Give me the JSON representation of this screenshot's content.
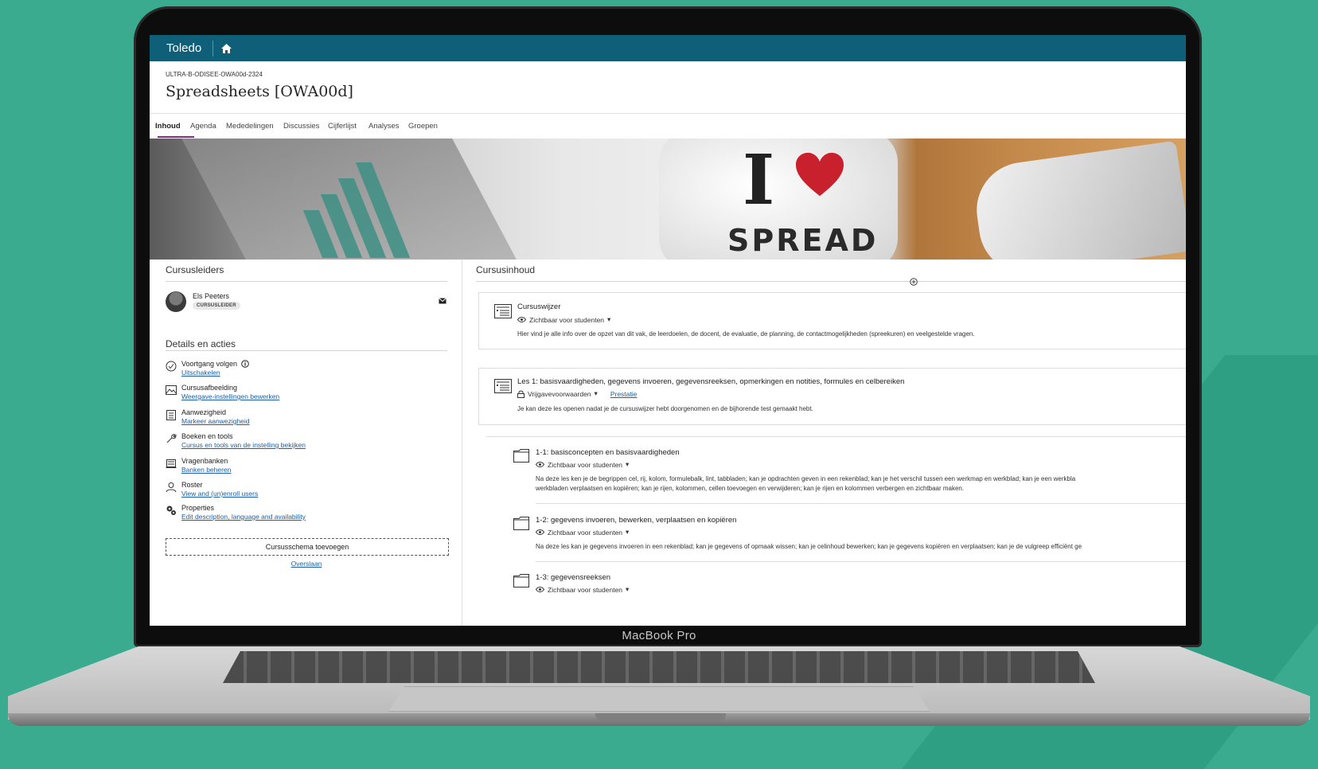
{
  "app": {
    "name": "Toledo"
  },
  "course": {
    "code": "ULTRA-B-ODISEE-OWA00d-2324",
    "title": "Spreadsheets [OWA00d]"
  },
  "tabs": [
    {
      "label": "Inhoud",
      "active": true
    },
    {
      "label": "Agenda"
    },
    {
      "label": "Mededelingen"
    },
    {
      "label": "Discussies"
    },
    {
      "label": "Cijferlijst"
    },
    {
      "label": "Analyses"
    },
    {
      "label": "Groepen"
    }
  ],
  "banner": {
    "mug_letter": "I",
    "mug_word": "SPREAD"
  },
  "leaders": {
    "heading": "Cursusleiders",
    "items": [
      {
        "name": "Els Peeters",
        "role": "CURSUSLEIDER"
      }
    ]
  },
  "details": {
    "heading": "Details en acties",
    "items": [
      {
        "icon": "progress-check-icon",
        "label": "Voortgang volgen",
        "link": "Uitschakelen"
      },
      {
        "icon": "image-icon",
        "label": "Cursusafbeelding",
        "link": "Weergave-instellingen bewerken"
      },
      {
        "icon": "attendance-icon",
        "label": "Aanwezigheid",
        "link": "Markeer aanwezigheid"
      },
      {
        "icon": "wrench-icon",
        "label": "Boeken en tools",
        "link": "Cursus en tools van de instelling bekijken"
      },
      {
        "icon": "question-bank-icon",
        "label": "Vragenbanken",
        "link": "Banken beheren"
      },
      {
        "icon": "roster-icon",
        "label": "Roster",
        "link": "View and (un)enroll users"
      },
      {
        "icon": "gears-icon",
        "label": "Properties",
        "link": "Edit description, language and availability"
      }
    ],
    "schedule_button": "Cursusschema toevoegen",
    "skip_link": "Overslaan"
  },
  "content": {
    "heading": "Cursusinhoud",
    "items": [
      {
        "title": "Cursuswijzer",
        "visibility": "Zichtbaar voor studenten",
        "desc": "Hier vind je alle info over de opzet van dit vak, de leerdoelen, de docent, de evaluatie, de planning, de contactmogelijkheden (spreekuren) en veelgestelde vragen."
      },
      {
        "title": "Les 1: basisvaardigheden, gegevens invoeren, gegevensreeksen, opmerkingen en notities, formules en celbereiken",
        "visibility": "Vrijgavevoorwaarden",
        "link": "Prestatie",
        "desc": "Je kan deze les openen nadat je de cursuswijzer hebt doorgenomen en de bijhorende test gemaakt hebt."
      }
    ],
    "subitems": [
      {
        "title": "1-1: basisconcepten en basisvaardigheden",
        "visibility": "Zichtbaar voor studenten",
        "desc1": "Na deze les ken je de begrippen cel, rij, kolom, formulebalk, lint, tabbladen; kan je opdrachten geven in een rekenblad; kan je het verschil tussen een werkmap en werkblad; kan je een werkbla",
        "desc2": "werkbladen verplaatsen en kopiëren; kan je rijen, kolommen, cellen toevoegen en verwijderen; kan je rijen en kolommen verbergen en zichtbaar maken."
      },
      {
        "title": "1-2: gegevens invoeren, bewerken, verplaatsen en kopiëren",
        "visibility": "Zichtbaar voor studenten",
        "desc1": "Na deze les kan je gegevens invoeren in een rekenblad; kan je gegevens of opmaak wissen; kan je celinhoud bewerken; kan je gegevens kopiëren en verplaatsen; kan je de vulgreep efficiënt ge"
      },
      {
        "title": "1-3: gegevensreeksen",
        "visibility": "Zichtbaar voor studenten"
      }
    ]
  },
  "device": {
    "label": "MacBook Pro"
  },
  "colors": {
    "topbar": "#0f5f79",
    "accent": "#8a2a8c",
    "link": "#1a5fa8",
    "background": "#3bab8f"
  }
}
